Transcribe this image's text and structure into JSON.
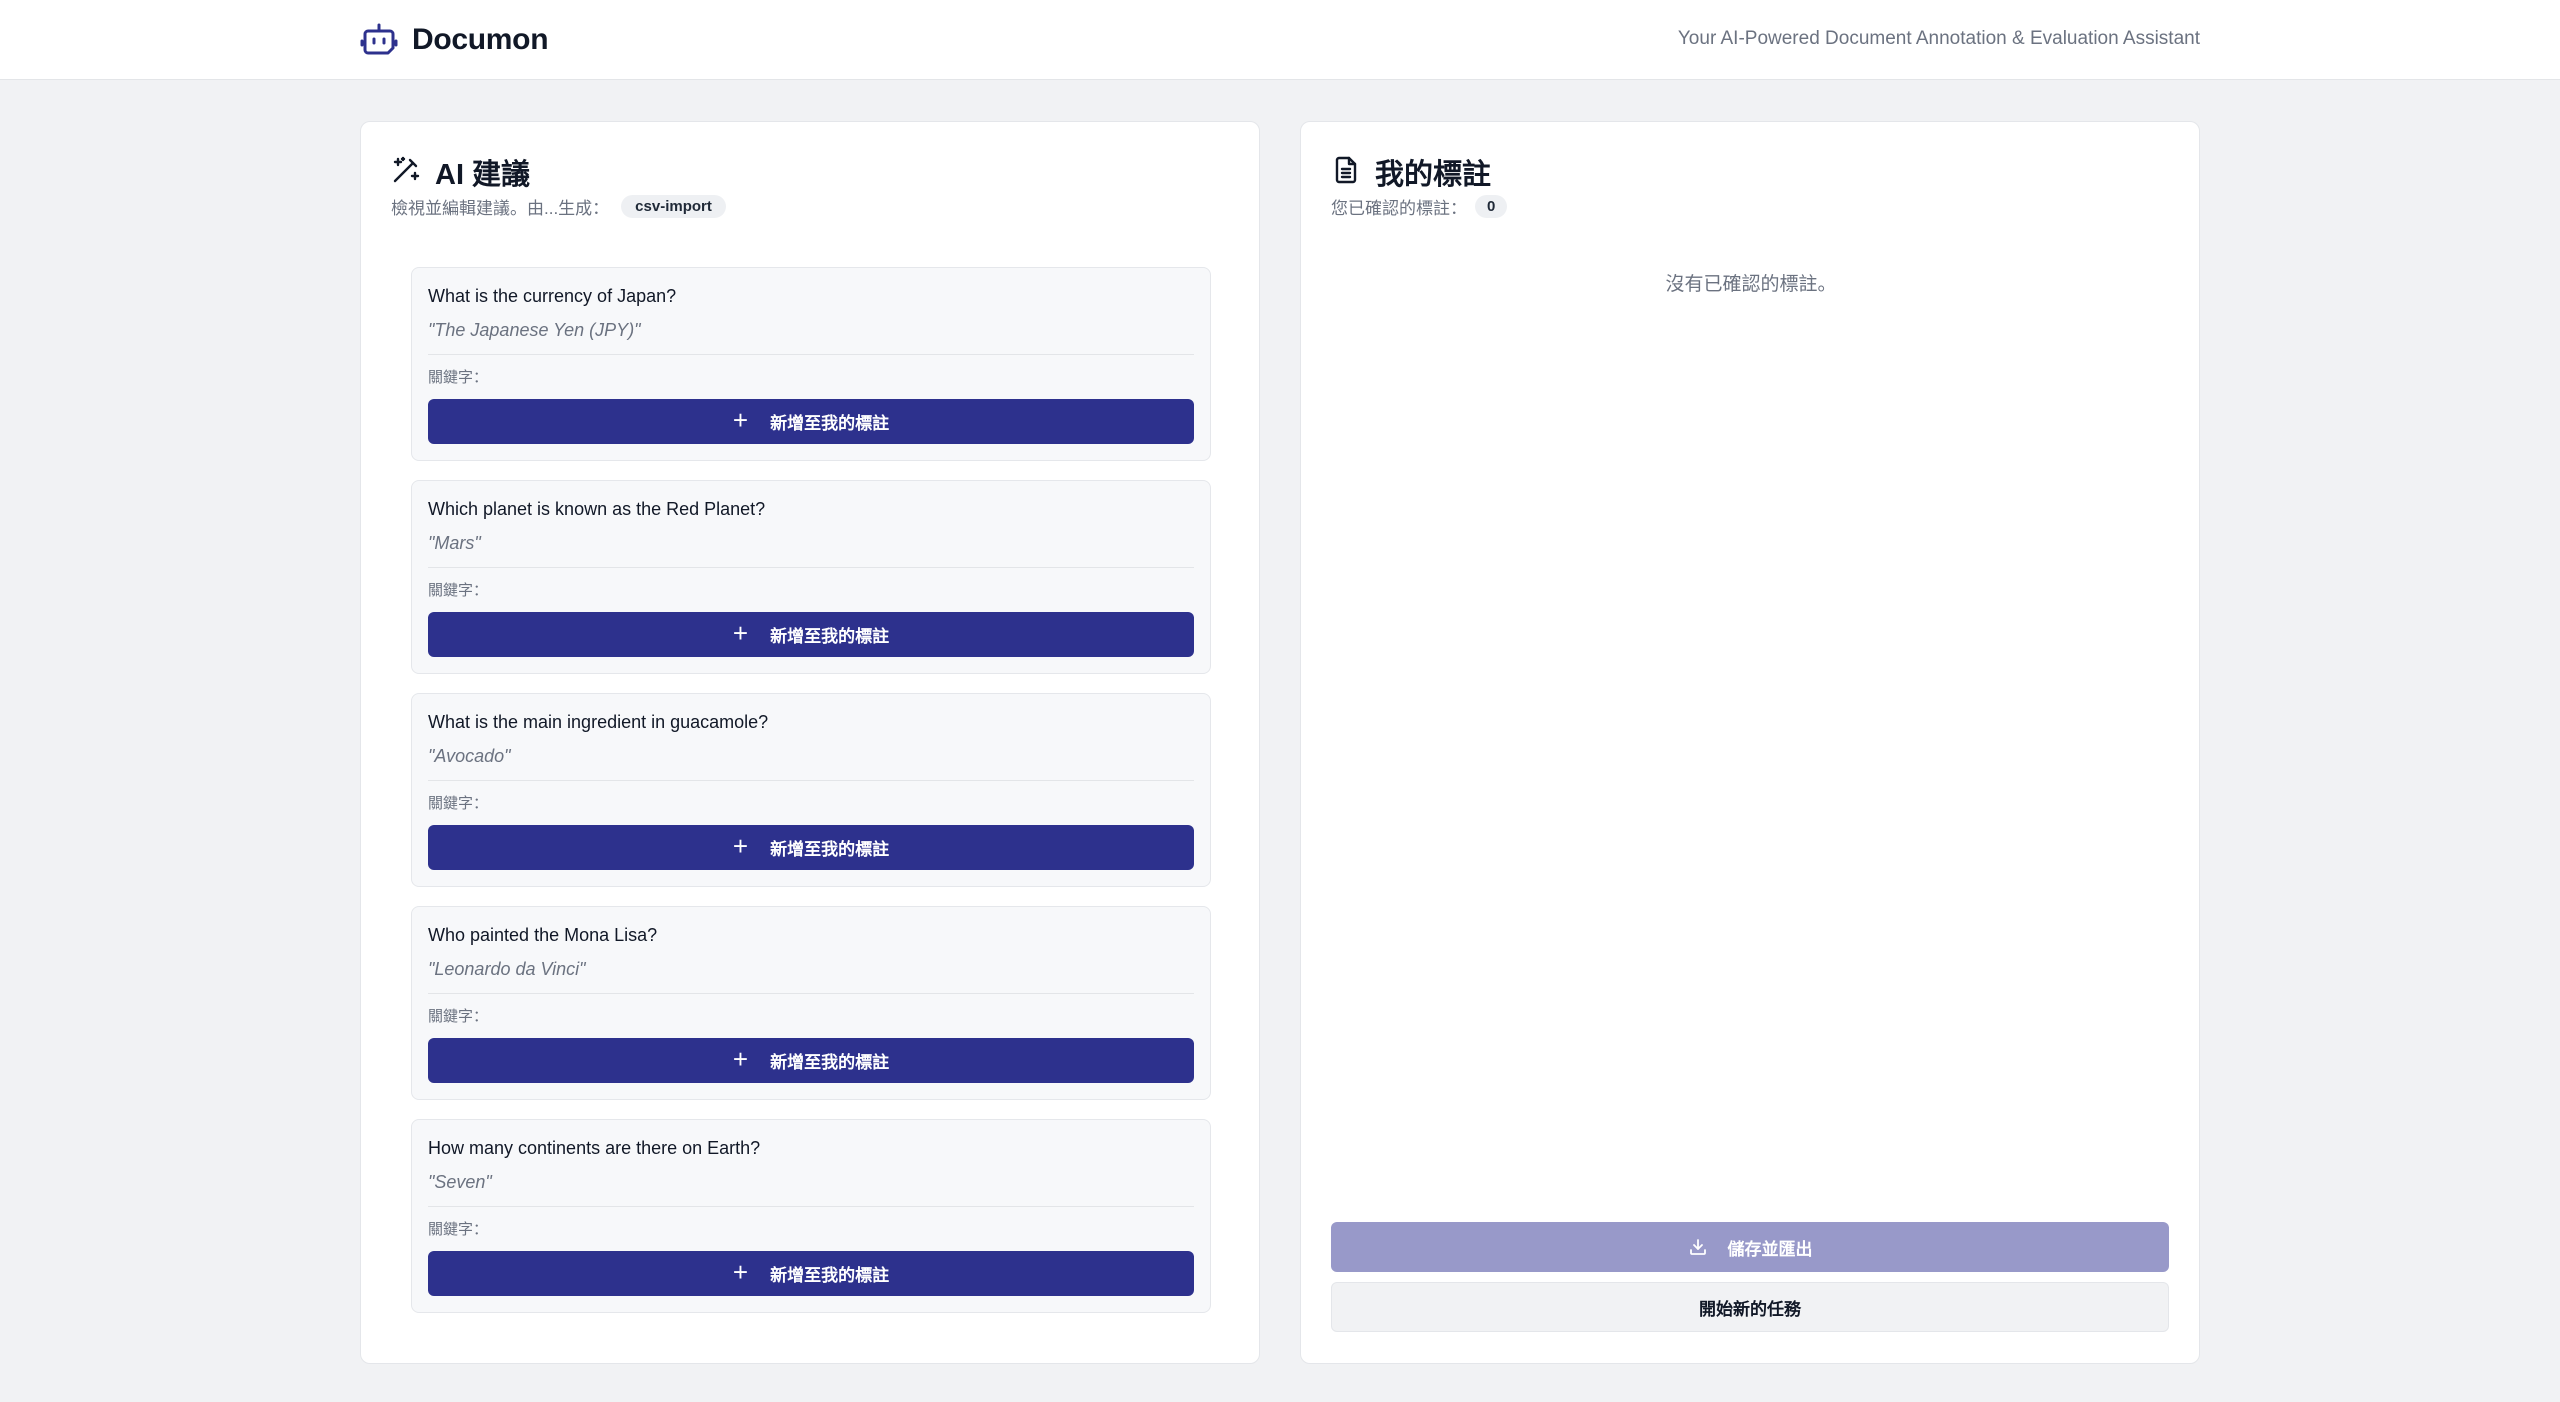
{
  "header": {
    "app_name": "Documon",
    "tagline": "Your AI-Powered Document Annotation & Evaluation Assistant",
    "logo_icon": "robot-icon"
  },
  "suggestions_panel": {
    "title": "AI 建議",
    "title_icon": "magic-wand-icon",
    "subtitle": "檢視並編輯建議。由...生成：",
    "source_badge": "csv-import",
    "items": [
      {
        "question": "What is the currency of Japan?",
        "answer": "\"The Japanese Yen (JPY)\"",
        "keywords_label": "關鍵字：",
        "add_label": "新增至我的標註"
      },
      {
        "question": "Which planet is known as the Red Planet?",
        "answer": "\"Mars\"",
        "keywords_label": "關鍵字：",
        "add_label": "新增至我的標註"
      },
      {
        "question": "What is the main ingredient in guacamole?",
        "answer": "\"Avocado\"",
        "keywords_label": "關鍵字：",
        "add_label": "新增至我的標註"
      },
      {
        "question": "Who painted the Mona Lisa?",
        "answer": "\"Leonardo da Vinci\"",
        "keywords_label": "關鍵字：",
        "add_label": "新增至我的標註"
      },
      {
        "question": "How many continents are there on Earth?",
        "answer": "\"Seven\"",
        "keywords_label": "關鍵字：",
        "add_label": "新增至我的標註"
      }
    ]
  },
  "annotations_panel": {
    "title": "我的標註",
    "title_icon": "document-icon",
    "subtitle": "您已確認的標註：",
    "count": "0",
    "empty_text": "沒有已確認的標註。",
    "export_label": "儲存並匯出",
    "export_icon": "download-icon",
    "new_task_label": "開始新的任務"
  },
  "colors": {
    "primary": "#2d318d",
    "primary_disabled": "#9899c9",
    "background": "#f1f2f4",
    "card": "#f7f8fa"
  }
}
